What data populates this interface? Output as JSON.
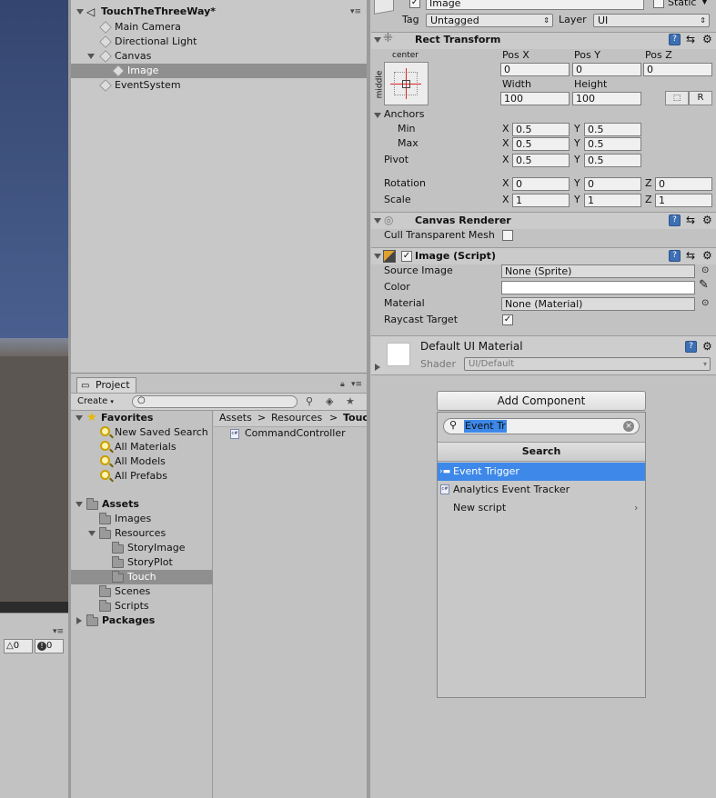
{
  "colors": {
    "scene_blue": "#3b4c7a",
    "scene_gray": "#5c5652",
    "selection_blue": "#3d88e8",
    "selected_row": "#8f8f8f",
    "panel_bg": "#c2c2c2"
  },
  "statusbar": {
    "warnings": "0",
    "errors": "0"
  },
  "hierarchy": {
    "scene_name": "TouchTheThreeWay*",
    "items": [
      {
        "label": "Main Camera"
      },
      {
        "label": "Directional Light"
      },
      {
        "label": "Canvas"
      },
      {
        "label": "Image"
      },
      {
        "label": "EventSystem"
      }
    ]
  },
  "project": {
    "tab_label": "Project",
    "create_label": "Create",
    "favorites": {
      "label": "Favorites",
      "items": [
        "New Saved Search",
        "All Materials",
        "All Models",
        "All Prefabs"
      ]
    },
    "assets": {
      "label": "Assets",
      "items": [
        "Images",
        "Resources",
        "StoryImage",
        "StoryPlot",
        "Touch",
        "Scenes",
        "Scripts"
      ]
    },
    "packages_label": "Packages",
    "breadcrumb": [
      "Assets",
      "Resources",
      "Touc"
    ],
    "files": [
      {
        "label": "CommandController"
      }
    ]
  },
  "inspector": {
    "object_name": "Image",
    "static_label": "Static",
    "tag_label": "Tag",
    "tag_value": "Untagged",
    "layer_label": "Layer",
    "layer_value": "UI",
    "rect_transform": {
      "title": "Rect Transform",
      "anchor_preset_top": "center",
      "anchor_preset_side": "middle",
      "pos_x_label": "Pos X",
      "pos_y_label": "Pos Y",
      "pos_z_label": "Pos Z",
      "pos_x": "0",
      "pos_y": "0",
      "pos_z": "0",
      "width_label": "Width",
      "height_label": "Height",
      "width": "100",
      "height": "100",
      "raw_button": "R",
      "anchors_label": "Anchors",
      "min_label": "Min",
      "max_label": "Max",
      "min_x": "0.5",
      "min_y": "0.5",
      "max_x": "0.5",
      "max_y": "0.5",
      "pivot_label": "Pivot",
      "pivot_x": "0.5",
      "pivot_y": "0.5",
      "rotation_label": "Rotation",
      "rot_x": "0",
      "rot_y": "0",
      "rot_z": "0",
      "scale_label": "Scale",
      "scale_x": "1",
      "scale_y": "1",
      "scale_z": "1",
      "x": "X",
      "y": "Y",
      "z": "Z"
    },
    "canvas_renderer": {
      "title": "Canvas Renderer",
      "cull_label": "Cull Transparent Mesh"
    },
    "image_script": {
      "title": "Image (Script)",
      "source_image_label": "Source Image",
      "source_image_value": "None (Sprite)",
      "color_label": "Color",
      "material_label": "Material",
      "material_value": "None (Material)",
      "raycast_label": "Raycast Target"
    },
    "material_preview": {
      "title": "Default UI Material",
      "shader_label": "Shader",
      "shader_value": "UI/Default"
    },
    "add_component": {
      "button_label": "Add Component",
      "search_value": "Event Tr",
      "header": "Search",
      "results": [
        {
          "label": "Event Trigger"
        },
        {
          "label": "Analytics Event Tracker"
        },
        {
          "label": "New script"
        }
      ]
    }
  }
}
